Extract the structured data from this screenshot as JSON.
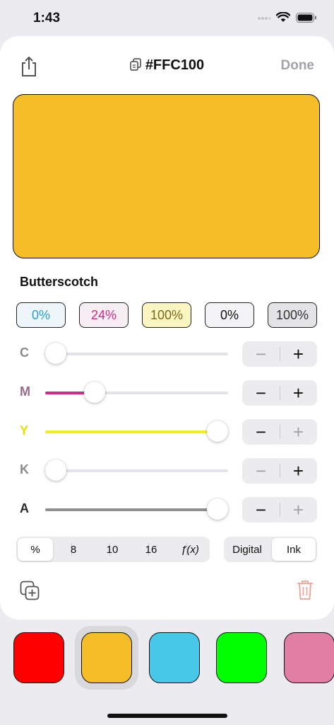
{
  "status_bar": {
    "time": "1:43"
  },
  "header": {
    "title": "#FFC100",
    "done_label": "Done"
  },
  "color": {
    "hex_color": "#f5bd27",
    "name": "Butterscotch"
  },
  "chips": [
    {
      "text": "0%",
      "text_color": "#2a9fd0",
      "bg": "#eef6fb"
    },
    {
      "text": "24%",
      "text_color": "#d42a86",
      "bg": "#f7eef3"
    },
    {
      "text": "100%",
      "text_color": "#7a6a1a",
      "bg": "#fbf5c2"
    },
    {
      "text": "0%",
      "text_color": "#111111",
      "bg": "#f3f3f5"
    },
    {
      "text": "100%",
      "text_color": "#333333",
      "bg": "#e4e4e7"
    }
  ],
  "sliders": [
    {
      "label": "C",
      "label_color": "#8a8a8e",
      "value_fraction": 0.0,
      "fill_color": "#2a9fd0",
      "minus_enabled": false,
      "plus_enabled": true
    },
    {
      "label": "M",
      "label_color": "#9b6a8a",
      "value_fraction": 0.24,
      "fill_color": "#d42a86",
      "minus_enabled": true,
      "plus_enabled": true
    },
    {
      "label": "Y",
      "label_color": "#e6e000",
      "value_fraction": 1.0,
      "fill_color": "#f2ee1a",
      "minus_enabled": true,
      "plus_enabled": false
    },
    {
      "label": "K",
      "label_color": "#8a8a8e",
      "value_fraction": 0.0,
      "fill_color": "#333333",
      "minus_enabled": false,
      "plus_enabled": true
    },
    {
      "label": "A",
      "label_color": "#2a2a2a",
      "value_fraction": 1.0,
      "fill_color": "#8e8e92",
      "minus_enabled": true,
      "plus_enabled": false
    }
  ],
  "format_segments": {
    "options": [
      "%",
      "8",
      "10",
      "16",
      "ƒ(x)"
    ],
    "selected": "%"
  },
  "mode_segments": {
    "options": [
      "Digital",
      "Ink"
    ],
    "selected": "Ink"
  },
  "palette": [
    {
      "color": "#ff0000",
      "selected": false
    },
    {
      "color": "#f5bd27",
      "selected": true
    },
    {
      "color": "#47c8e8",
      "selected": false
    },
    {
      "color": "#00ff00",
      "selected": false
    },
    {
      "color": "#e07fa2",
      "selected": false
    }
  ],
  "icons": {
    "share": "share-icon",
    "copy": "copy-icon",
    "duplicate": "duplicate-icon",
    "trash": "trash-icon",
    "wifi": "wifi-icon",
    "battery": "battery-icon",
    "signal": "signal-icon"
  },
  "accent": {
    "trash_color": "#f2a193",
    "disabled_color": "#a2a2a7"
  }
}
